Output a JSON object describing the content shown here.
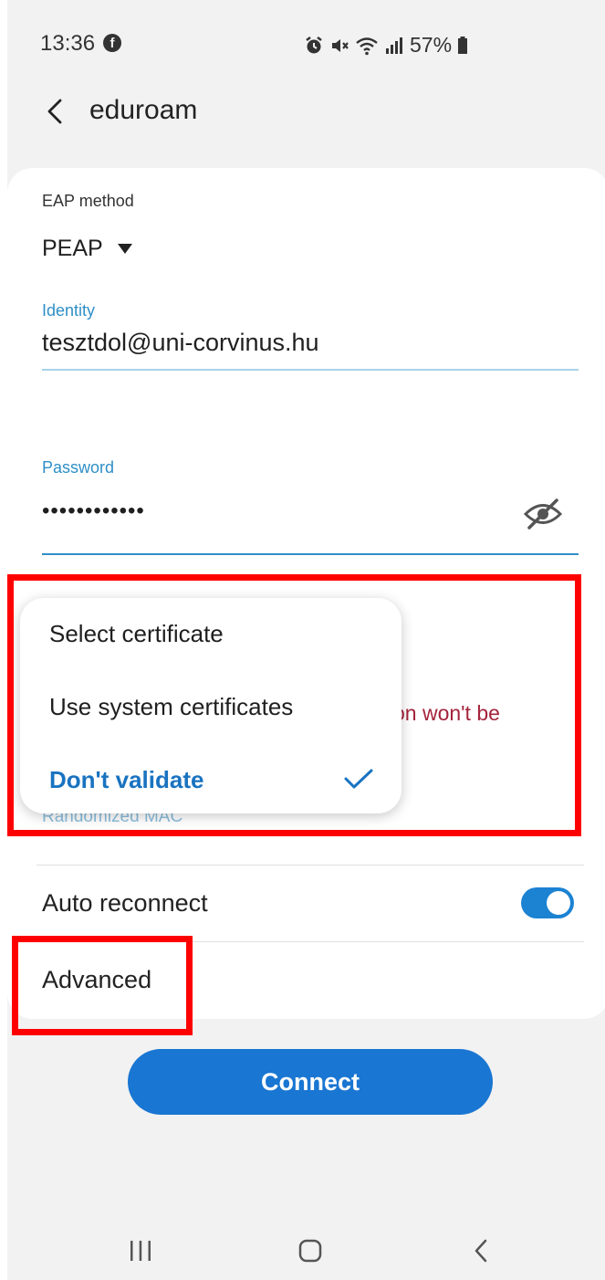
{
  "status_bar": {
    "time": "13:36",
    "battery": "57%",
    "icons": [
      "facebook-icon",
      "alarm-icon",
      "mute-icon",
      "wifi-icon",
      "signal-icon",
      "battery-icon"
    ]
  },
  "header": {
    "title": "eduroam"
  },
  "form": {
    "eap_label": "EAP method",
    "eap_value": "PEAP",
    "identity_label": "Identity",
    "identity_value": "tesztdol@uni-corvinus.hu",
    "password_label": "Password",
    "password_value": "••••••••••••",
    "warning_text": "ction won't be",
    "partial_label": "Randomized MAC",
    "auto_reconnect_label": "Auto reconnect",
    "auto_reconnect_on": true,
    "advanced_label": "Advanced"
  },
  "dropdown": {
    "items": [
      {
        "label": "Select certificate",
        "selected": false
      },
      {
        "label": "Use system certificates",
        "selected": false
      },
      {
        "label": "Don't validate",
        "selected": true
      }
    ]
  },
  "connect_label": "Connect",
  "colors": {
    "accent": "#1976d2",
    "field_label": "#2f8fc7",
    "warning": "#a4243b",
    "annotation": "#ff0000"
  }
}
